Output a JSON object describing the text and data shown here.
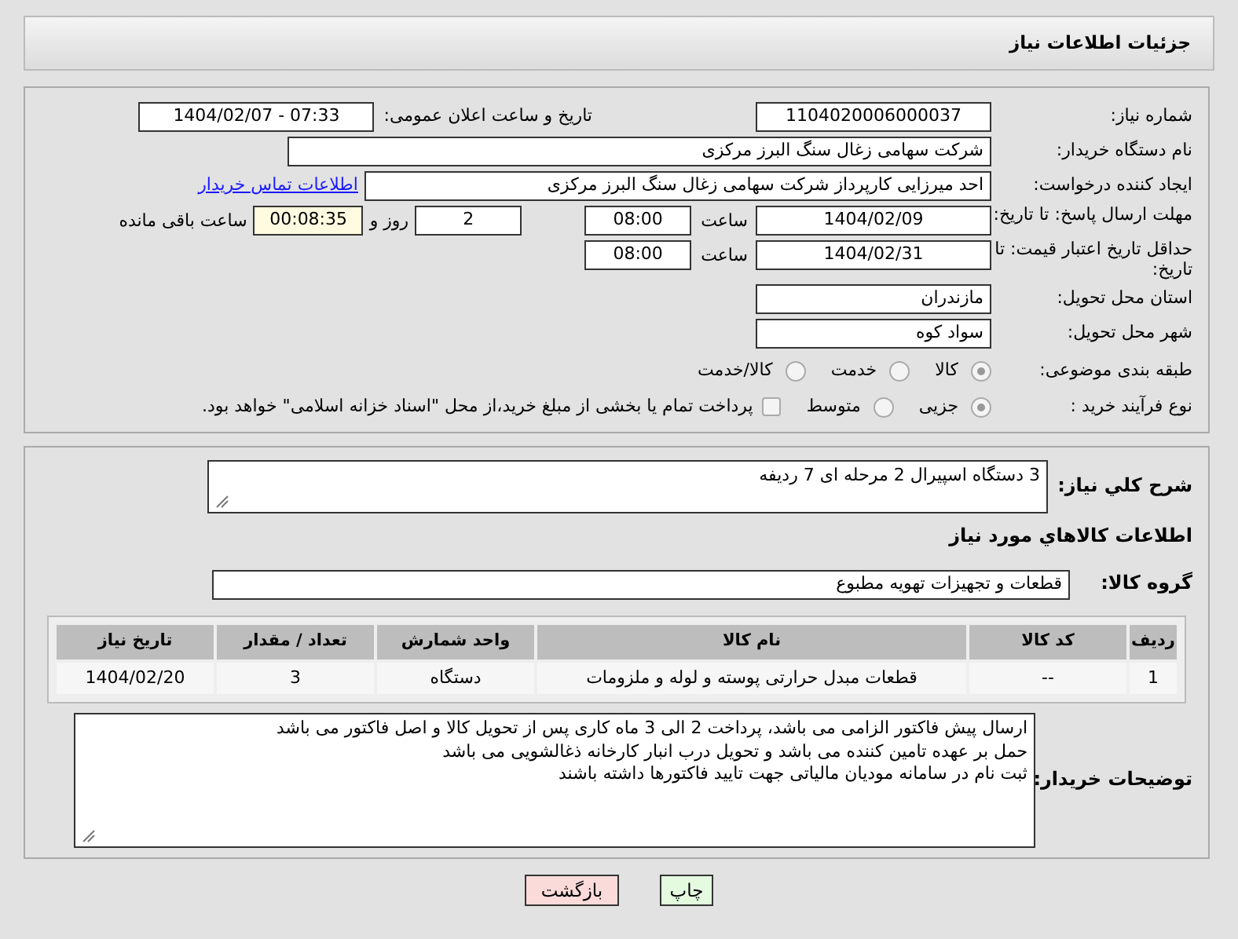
{
  "header": {
    "title": "جزئیات اطلاعات نیاز"
  },
  "details": {
    "need_number": {
      "label": "شماره نیاز:",
      "value": "1104020006000037"
    },
    "announce": {
      "label": "تاریخ و ساعت اعلان عمومی:",
      "value": "1404/02/07 - 07:33"
    },
    "buyer": {
      "label": "نام دستگاه خریدار:",
      "value": "شرکت سهامی زغال سنگ البرز مرکزی"
    },
    "creator": {
      "label": "ایجاد کننده درخواست:",
      "value": "احد میرزایی کارپرداز شرکت سهامی زغال سنگ البرز مرکزی",
      "link": "اطلاعات تماس خریدار"
    },
    "deadline": {
      "label": "مهلت ارسال پاسخ: تا تاریخ:",
      "date": "1404/02/09",
      "time_label": "ساعت",
      "time": "08:00",
      "days": "2",
      "days_label": "روز و",
      "remaining": "00:08:35",
      "remaining_label": "ساعت باقی مانده"
    },
    "validity": {
      "label": "حداقل تاریخ اعتبار قیمت: تا تاریخ:",
      "date": "1404/02/31",
      "time_label": "ساعت",
      "time": "08:00"
    },
    "province": {
      "label": "استان محل تحویل:",
      "value": "مازندران"
    },
    "city": {
      "label": "شهر محل تحویل:",
      "value": "سواد کوه"
    },
    "category": {
      "label": "طبقه بندی موضوعی:",
      "options": [
        {
          "label": "کالا",
          "selected": true
        },
        {
          "label": "خدمت",
          "selected": false
        },
        {
          "label": "کالا/خدمت",
          "selected": false
        }
      ]
    },
    "process": {
      "label": "نوع فرآیند خرید :",
      "options": [
        {
          "label": "جزیی",
          "selected": true
        },
        {
          "label": "متوسط",
          "selected": false
        }
      ],
      "treasury": {
        "label": "پرداخت تمام یا بخشی از مبلغ خرید،از محل \"اسناد خزانه اسلامی\" خواهد بود.",
        "checked": false
      }
    }
  },
  "summary": {
    "label": "شرح كلي نياز:",
    "value": "3 دستگاه اسپیرال 2 مرحله ای 7 ردیفه"
  },
  "goods_heading": "اطلاعات كالاهاي مورد نياز",
  "goods_group": {
    "label": "گروه کالا:",
    "value": "قطعات و تجهیزات تهویه مطبوع"
  },
  "table": {
    "columns": [
      "ردیف",
      "کد کالا",
      "نام کالا",
      "واحد شمارش",
      "تعداد / مقدار",
      "تاریخ نیاز"
    ],
    "rows": [
      [
        "1",
        "--",
        "قطعات مبدل حرارتی پوسته و لوله و ملزومات",
        "دستگاه",
        "3",
        "1404/02/20"
      ]
    ]
  },
  "buyer_notes": {
    "label": "توضیحات خریدار:",
    "lines": [
      "ارسال پیش فاکتور الزامی می باشد، پرداخت 2 الی 3 ماه کاری پس از تحویل کالا و اصل فاکتور می باشد",
      "حمل بر عهده تامین کننده می باشد و تحویل درب انبار کارخانه ذغالشویی می باشد",
      "ثبت نام در سامانه مودیان مالیاتی جهت تایید فاکتورها داشته باشند"
    ]
  },
  "buttons": [
    {
      "label": "چاپ",
      "kind": "print"
    },
    {
      "label": "بازگشت",
      "kind": "back"
    }
  ]
}
